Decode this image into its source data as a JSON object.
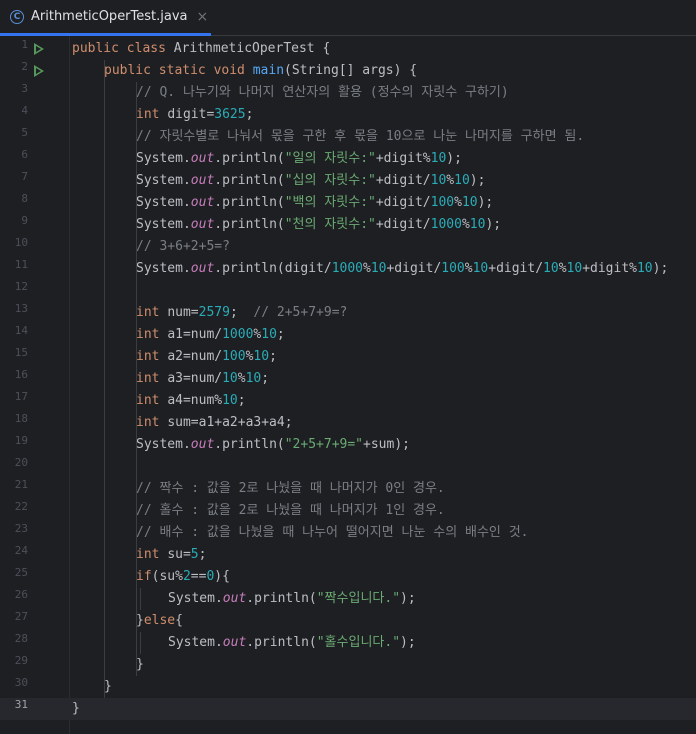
{
  "tab": {
    "icon_letter": "C",
    "title": "ArithmeticOperTest.java",
    "close_glyph": "×",
    "icon": "class-icon"
  },
  "editor": {
    "current_line": 31,
    "lines": [
      {
        "n": "1",
        "run": true,
        "indent": 0,
        "tokens": [
          [
            "kw",
            "public class "
          ],
          [
            "cls",
            "ArithmeticOperTest "
          ],
          [
            "cls",
            "{"
          ]
        ]
      },
      {
        "n": "2",
        "run": true,
        "indent": 1,
        "tokens": [
          [
            "kw",
            "public static void "
          ],
          [
            "fn",
            "main"
          ],
          [
            "cls",
            "(String[] args) {"
          ]
        ]
      },
      {
        "n": "3",
        "indent": 2,
        "tokens": [
          [
            "cm",
            "// Q. 나누기와 나머지 연산자의 활용 (정수의 자릿수 구하기)"
          ]
        ]
      },
      {
        "n": "4",
        "indent": 2,
        "tokens": [
          [
            "kw",
            "int "
          ],
          [
            "cls",
            "digit="
          ],
          [
            "num",
            "3625"
          ],
          [
            "cls",
            ";"
          ]
        ]
      },
      {
        "n": "5",
        "indent": 2,
        "tokens": [
          [
            "cm",
            "// 자릿수별로 나눠서 몫을 구한 후 몫을 10으로 나눈 나머지를 구하면 됨."
          ]
        ]
      },
      {
        "n": "6",
        "indent": 2,
        "tokens": [
          [
            "cls",
            "System."
          ],
          [
            "st",
            "out"
          ],
          [
            "cls",
            ".println("
          ],
          [
            "str",
            "\"일의 자릿수:\""
          ],
          [
            "cls",
            "+digit%"
          ],
          [
            "num",
            "10"
          ],
          [
            "cls",
            ");"
          ]
        ]
      },
      {
        "n": "7",
        "indent": 2,
        "tokens": [
          [
            "cls",
            "System."
          ],
          [
            "st",
            "out"
          ],
          [
            "cls",
            ".println("
          ],
          [
            "str",
            "\"십의 자릿수:\""
          ],
          [
            "cls",
            "+digit/"
          ],
          [
            "num",
            "10"
          ],
          [
            "cls",
            "%"
          ],
          [
            "num",
            "10"
          ],
          [
            "cls",
            ");"
          ]
        ]
      },
      {
        "n": "8",
        "indent": 2,
        "tokens": [
          [
            "cls",
            "System."
          ],
          [
            "st",
            "out"
          ],
          [
            "cls",
            ".println("
          ],
          [
            "str",
            "\"백의 자릿수:\""
          ],
          [
            "cls",
            "+digit/"
          ],
          [
            "num",
            "100"
          ],
          [
            "cls",
            "%"
          ],
          [
            "num",
            "10"
          ],
          [
            "cls",
            ");"
          ]
        ]
      },
      {
        "n": "9",
        "indent": 2,
        "tokens": [
          [
            "cls",
            "System."
          ],
          [
            "st",
            "out"
          ],
          [
            "cls",
            ".println("
          ],
          [
            "str",
            "\"천의 자릿수:\""
          ],
          [
            "cls",
            "+digit/"
          ],
          [
            "num",
            "1000"
          ],
          [
            "cls",
            "%"
          ],
          [
            "num",
            "10"
          ],
          [
            "cls",
            ");"
          ]
        ]
      },
      {
        "n": "10",
        "indent": 2,
        "tokens": [
          [
            "cm",
            "// 3+6+2+5=?"
          ]
        ]
      },
      {
        "n": "11",
        "indent": 2,
        "tokens": [
          [
            "cls",
            "System."
          ],
          [
            "st",
            "out"
          ],
          [
            "cls",
            ".println(digit/"
          ],
          [
            "num",
            "1000"
          ],
          [
            "cls",
            "%"
          ],
          [
            "num",
            "10"
          ],
          [
            "cls",
            "+digit/"
          ],
          [
            "num",
            "100"
          ],
          [
            "cls",
            "%"
          ],
          [
            "num",
            "10"
          ],
          [
            "cls",
            "+digit/"
          ],
          [
            "num",
            "10"
          ],
          [
            "cls",
            "%"
          ],
          [
            "num",
            "10"
          ],
          [
            "cls",
            "+digit%"
          ],
          [
            "num",
            "10"
          ],
          [
            "cls",
            ");"
          ]
        ]
      },
      {
        "n": "12",
        "indent": 2,
        "tokens": []
      },
      {
        "n": "13",
        "indent": 2,
        "tokens": [
          [
            "kw",
            "int "
          ],
          [
            "cls",
            "num="
          ],
          [
            "num",
            "2579"
          ],
          [
            "cls",
            ";  "
          ],
          [
            "cm",
            "// 2+5+7+9=?"
          ]
        ]
      },
      {
        "n": "14",
        "indent": 2,
        "tokens": [
          [
            "kw",
            "int "
          ],
          [
            "cls",
            "a1=num/"
          ],
          [
            "num",
            "1000"
          ],
          [
            "cls",
            "%"
          ],
          [
            "num",
            "10"
          ],
          [
            "cls",
            ";"
          ]
        ]
      },
      {
        "n": "15",
        "indent": 2,
        "tokens": [
          [
            "kw",
            "int "
          ],
          [
            "cls",
            "a2=num/"
          ],
          [
            "num",
            "100"
          ],
          [
            "cls",
            "%"
          ],
          [
            "num",
            "10"
          ],
          [
            "cls",
            ";"
          ]
        ]
      },
      {
        "n": "16",
        "indent": 2,
        "tokens": [
          [
            "kw",
            "int "
          ],
          [
            "cls",
            "a3=num/"
          ],
          [
            "num",
            "10"
          ],
          [
            "cls",
            "%"
          ],
          [
            "num",
            "10"
          ],
          [
            "cls",
            ";"
          ]
        ]
      },
      {
        "n": "17",
        "indent": 2,
        "tokens": [
          [
            "kw",
            "int "
          ],
          [
            "cls",
            "a4=num%"
          ],
          [
            "num",
            "10"
          ],
          [
            "cls",
            ";"
          ]
        ]
      },
      {
        "n": "18",
        "indent": 2,
        "tokens": [
          [
            "kw",
            "int "
          ],
          [
            "cls",
            "sum=a1+a2+a3+a4;"
          ]
        ]
      },
      {
        "n": "19",
        "indent": 2,
        "tokens": [
          [
            "cls",
            "System."
          ],
          [
            "st",
            "out"
          ],
          [
            "cls",
            ".println("
          ],
          [
            "str",
            "\"2+5+7+9=\""
          ],
          [
            "cls",
            "+sum);"
          ]
        ]
      },
      {
        "n": "20",
        "indent": 2,
        "tokens": []
      },
      {
        "n": "21",
        "indent": 2,
        "tokens": [
          [
            "cm",
            "// 짝수 : 값을 2로 나눴을 때 나머지가 0인 경우."
          ]
        ]
      },
      {
        "n": "22",
        "indent": 2,
        "tokens": [
          [
            "cm",
            "// 홀수 : 값을 2로 나눴을 때 나머지가 1인 경우."
          ]
        ]
      },
      {
        "n": "23",
        "indent": 2,
        "tokens": [
          [
            "cm",
            "// 배수 : 값을 나눴을 때 나누어 떨어지면 나눈 수의 배수인 것."
          ]
        ]
      },
      {
        "n": "24",
        "indent": 2,
        "tokens": [
          [
            "kw",
            "int "
          ],
          [
            "cls",
            "su="
          ],
          [
            "num",
            "5"
          ],
          [
            "cls",
            ";"
          ]
        ]
      },
      {
        "n": "25",
        "indent": 2,
        "tokens": [
          [
            "kw",
            "if"
          ],
          [
            "cls",
            "(su%"
          ],
          [
            "num",
            "2"
          ],
          [
            "cls",
            "=="
          ],
          [
            "num",
            "0"
          ],
          [
            "cls",
            "){"
          ]
        ]
      },
      {
        "n": "26",
        "indent": 3,
        "tokens": [
          [
            "cls",
            "System."
          ],
          [
            "st",
            "out"
          ],
          [
            "cls",
            ".println("
          ],
          [
            "str",
            "\"짝수입니다.\""
          ],
          [
            "cls",
            ");"
          ]
        ]
      },
      {
        "n": "27",
        "indent": 2,
        "tokens": [
          [
            "cls",
            "}"
          ],
          [
            "kw",
            "else"
          ],
          [
            "cls",
            "{"
          ]
        ]
      },
      {
        "n": "28",
        "indent": 3,
        "tokens": [
          [
            "cls",
            "System."
          ],
          [
            "st",
            "out"
          ],
          [
            "cls",
            ".println("
          ],
          [
            "str",
            "\"홀수입니다.\""
          ],
          [
            "cls",
            ");"
          ]
        ]
      },
      {
        "n": "29",
        "indent": 2,
        "tokens": [
          [
            "cls",
            "}"
          ]
        ]
      },
      {
        "n": "30",
        "indent": 1,
        "tokens": [
          [
            "cls",
            "}"
          ]
        ]
      },
      {
        "n": "31",
        "indent": 0,
        "tokens": [
          [
            "cls",
            "}"
          ]
        ]
      }
    ]
  }
}
